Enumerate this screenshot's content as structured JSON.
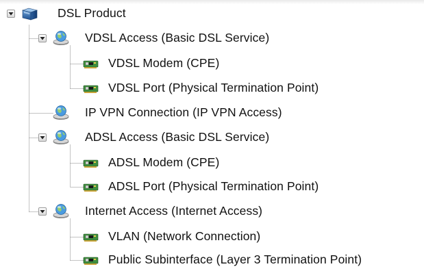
{
  "tree": {
    "root": {
      "label": "DSL Product",
      "icon": "product-box-icon",
      "expanded": true,
      "children": [
        {
          "label": "VDSL Access (Basic DSL Service)",
          "icon": "network-service-globe-icon",
          "expanded": true,
          "children": [
            {
              "label": "VDSL Modem (CPE)",
              "icon": "network-card-icon"
            },
            {
              "label": "VDSL Port (Physical Termination Point)",
              "icon": "network-card-icon"
            }
          ]
        },
        {
          "label": "IP VPN Connection (IP VPN Access)",
          "icon": "network-service-globe-icon"
        },
        {
          "label": "ADSL Access (Basic DSL Service)",
          "icon": "network-service-globe-icon",
          "expanded": true,
          "children": [
            {
              "label": "ADSL Modem (CPE)",
              "icon": "network-card-icon"
            },
            {
              "label": "ADSL Port (Physical Termination Point)",
              "icon": "network-card-icon"
            }
          ]
        },
        {
          "label": "Internet Access (Internet Access)",
          "icon": "network-service-globe-icon",
          "expanded": true,
          "children": [
            {
              "label": "VLAN (Network Connection)",
              "icon": "network-card-icon"
            },
            {
              "label": "Public Subinterface (Layer 3 Termination Point)",
              "icon": "network-card-icon"
            }
          ]
        }
      ]
    }
  },
  "colors": {
    "tree_line": "#8a8a8a",
    "text": "#111111",
    "background": "#ffffff"
  }
}
